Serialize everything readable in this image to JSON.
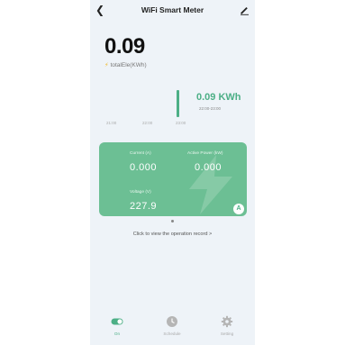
{
  "header": {
    "title": "WiFi Smart Meter"
  },
  "total": {
    "value": "0.09",
    "label": "totalEle(KWh)"
  },
  "history": {
    "reading_value": "0.09 KWh",
    "reading_time": "22:00-23:00",
    "ticks": [
      "21:00",
      "22:00",
      "23:00"
    ]
  },
  "card": {
    "current_label": "Current (A)",
    "current_value": "0.000",
    "power_label": "Active Power (kW)",
    "power_value": "0.000",
    "voltage_label": "Voltage (V)",
    "voltage_value": "227.9",
    "badge": "A"
  },
  "record_link": "Click to view the operation record >",
  "nav": [
    {
      "label": "On",
      "icon": "toggle-icon",
      "color": "#4caf86"
    },
    {
      "label": "Schedule",
      "icon": "clock-icon",
      "color": "#b5b5b5"
    },
    {
      "label": "Setting",
      "icon": "gear-icon",
      "color": "#b5b5b5"
    }
  ],
  "colors": {
    "accent": "#4caf86",
    "card": "#6cbf94",
    "screen_bg": "#eef3f8"
  }
}
